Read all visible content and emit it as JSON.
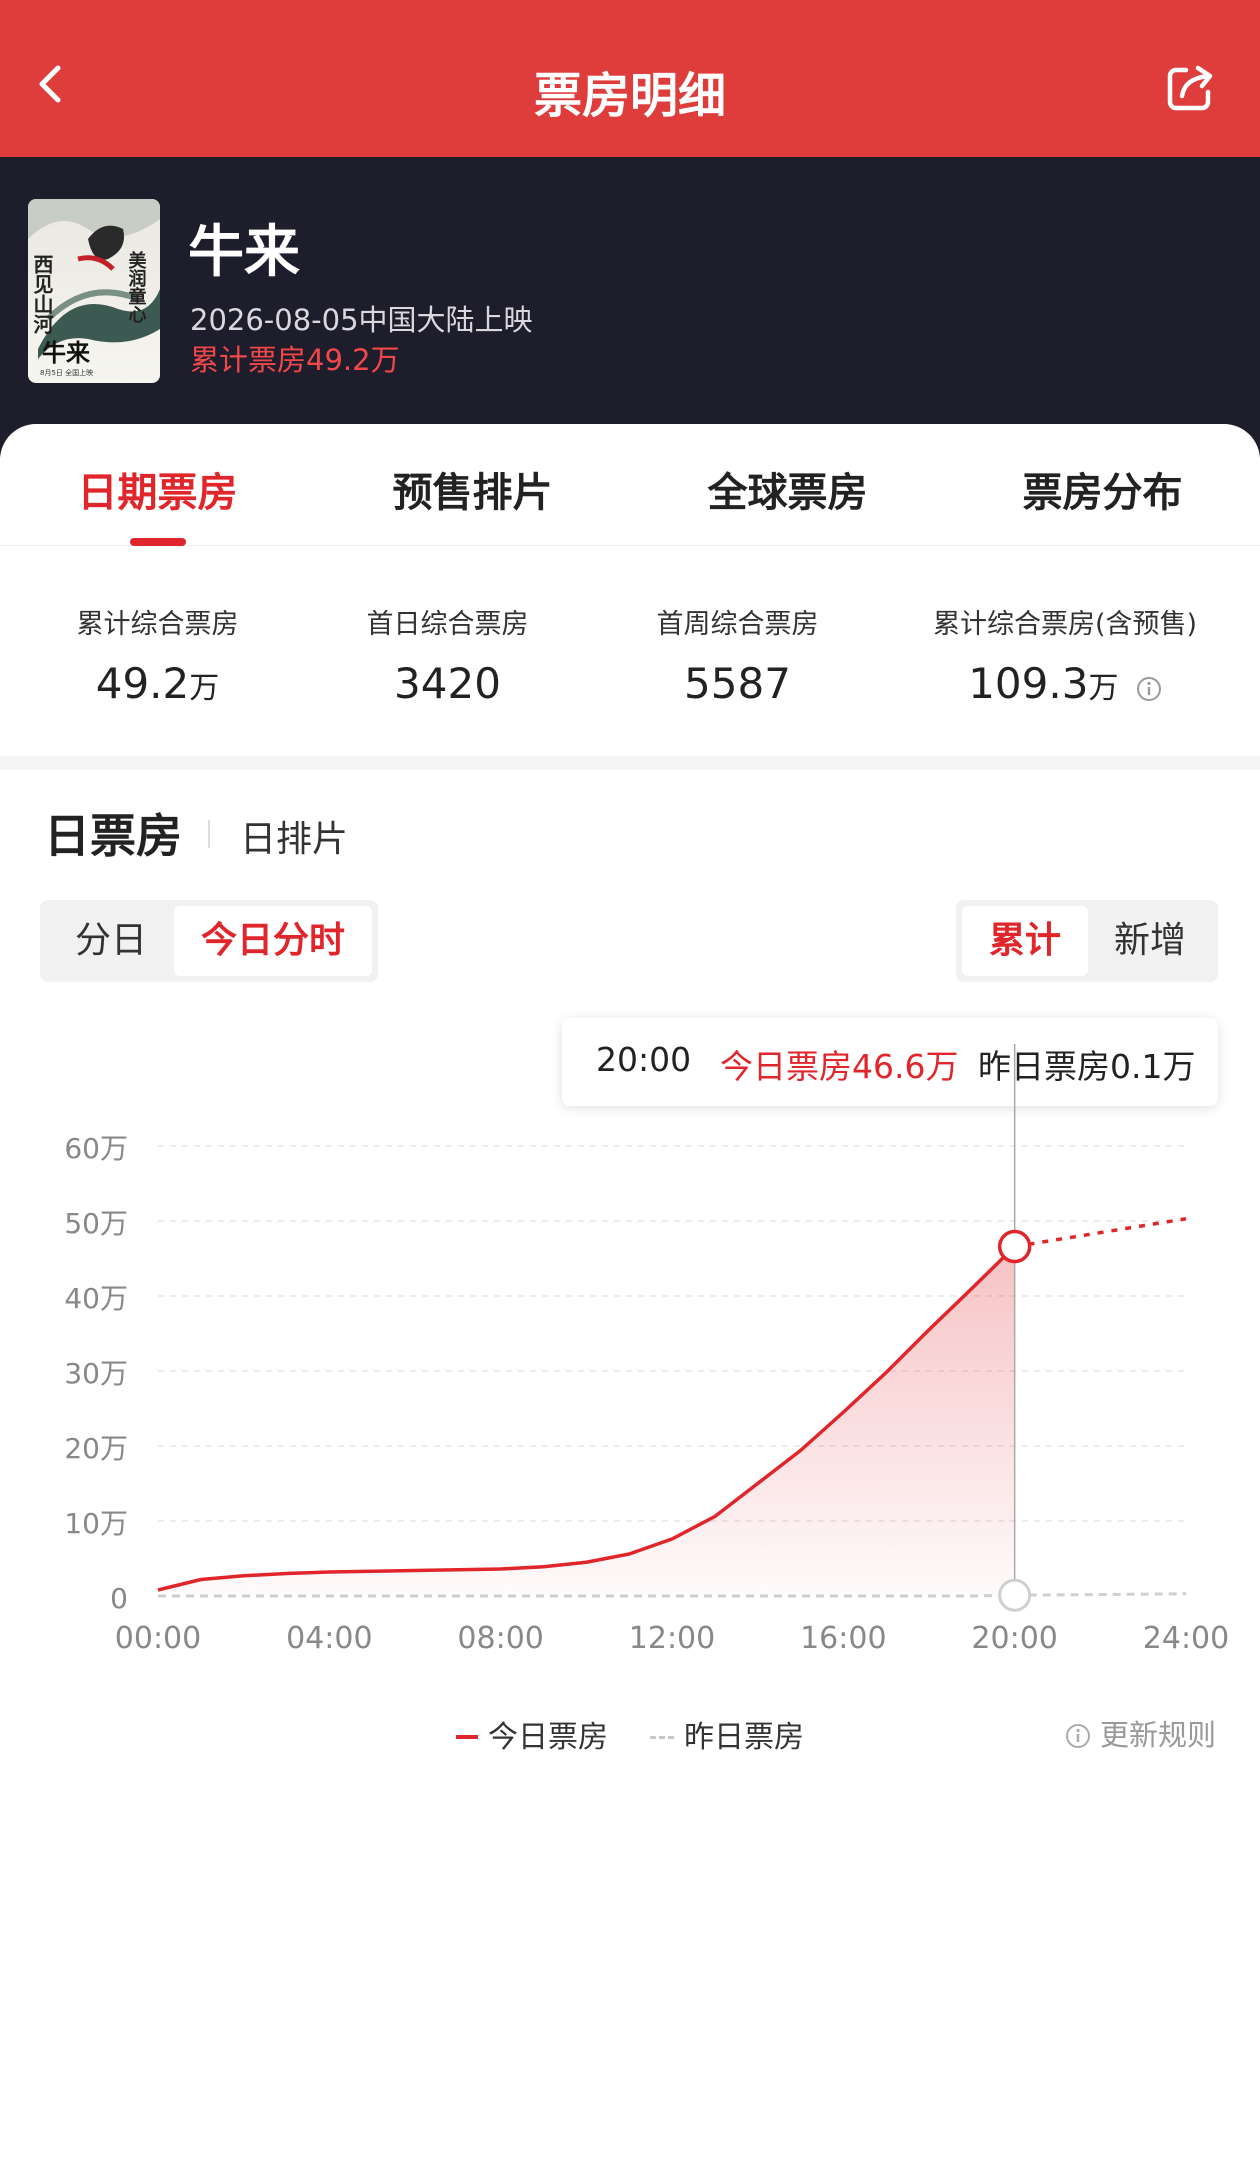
{
  "header": {
    "title": "票房明细"
  },
  "movie": {
    "name": "牛来",
    "release": "2026-08-05中国大陆上映",
    "total": "累计票房49.2万",
    "poster_text": [
      "美润童心",
      "西见山河",
      "牛来",
      "8月5日 全国上映"
    ]
  },
  "tabs": [
    {
      "label": "日期票房",
      "active": true
    },
    {
      "label": "预售排片",
      "active": false
    },
    {
      "label": "全球票房",
      "active": false
    },
    {
      "label": "票房分布",
      "active": false
    }
  ],
  "stats": [
    {
      "label": "累计综合票房",
      "value": "49.2",
      "unit": "万"
    },
    {
      "label": "首日综合票房",
      "value": "3420",
      "unit": ""
    },
    {
      "label": "首周综合票房",
      "value": "5587",
      "unit": ""
    },
    {
      "label": "累计综合票房(含预售)",
      "value": "109.3",
      "unit": "万"
    }
  ],
  "section": {
    "title": "日票房",
    "alt": "日排片"
  },
  "toggle_left": [
    {
      "label": "分日",
      "active": false
    },
    {
      "label": "今日分时",
      "active": true
    }
  ],
  "toggle_right": [
    {
      "label": "累计",
      "active": true
    },
    {
      "label": "新增",
      "active": false
    }
  ],
  "tooltip": {
    "time": "20:00",
    "today": "今日票房46.6万",
    "yesterday": "昨日票房0.1万"
  },
  "legend": {
    "today": "今日票房",
    "yesterday": "昨日票房",
    "rules": "更新规则"
  },
  "colors": {
    "brand": "#df3c3c",
    "accent": "#e0252b",
    "dark": "#1e1d2b"
  },
  "chart_data": {
    "type": "line",
    "x": [
      "00:00",
      "01:00",
      "02:00",
      "03:00",
      "04:00",
      "05:00",
      "06:00",
      "07:00",
      "08:00",
      "09:00",
      "10:00",
      "11:00",
      "12:00",
      "13:00",
      "14:00",
      "15:00",
      "16:00",
      "17:00",
      "18:00",
      "19:00",
      "20:00"
    ],
    "x_tick_labels": [
      "00:00",
      "04:00",
      "08:00",
      "12:00",
      "16:00",
      "20:00",
      "24:00"
    ],
    "y_tick_labels": [
      "0",
      "10万",
      "20万",
      "30万",
      "40万",
      "50万",
      "60万"
    ],
    "ylim": [
      0,
      60
    ],
    "y_unit": "万",
    "series": [
      {
        "name": "今日票房",
        "values": [
          0.8,
          2.2,
          2.7,
          3.0,
          3.2,
          3.3,
          3.4,
          3.5,
          3.6,
          3.9,
          4.5,
          5.6,
          7.6,
          10.6,
          15.0,
          19.4,
          24.5,
          29.8,
          35.5,
          41.0,
          46.6
        ]
      },
      {
        "name": "昨日票房",
        "values": [
          0.0,
          0.0,
          0.0,
          0.0,
          0.0,
          0.0,
          0.0,
          0.0,
          0.0,
          0.0,
          0.0,
          0.0,
          0.0,
          0.0,
          0.0,
          0.0,
          0.0,
          0.0,
          0.0,
          0.0,
          0.1
        ]
      }
    ],
    "projection": {
      "x": [
        "20:00",
        "24:00"
      ],
      "values": [
        46.6,
        50.3
      ]
    },
    "yesterday_projection": {
      "x": [
        "20:00",
        "24:00"
      ],
      "values": [
        0.1,
        0.3
      ]
    },
    "marker_x": "20:00",
    "grid": true
  }
}
